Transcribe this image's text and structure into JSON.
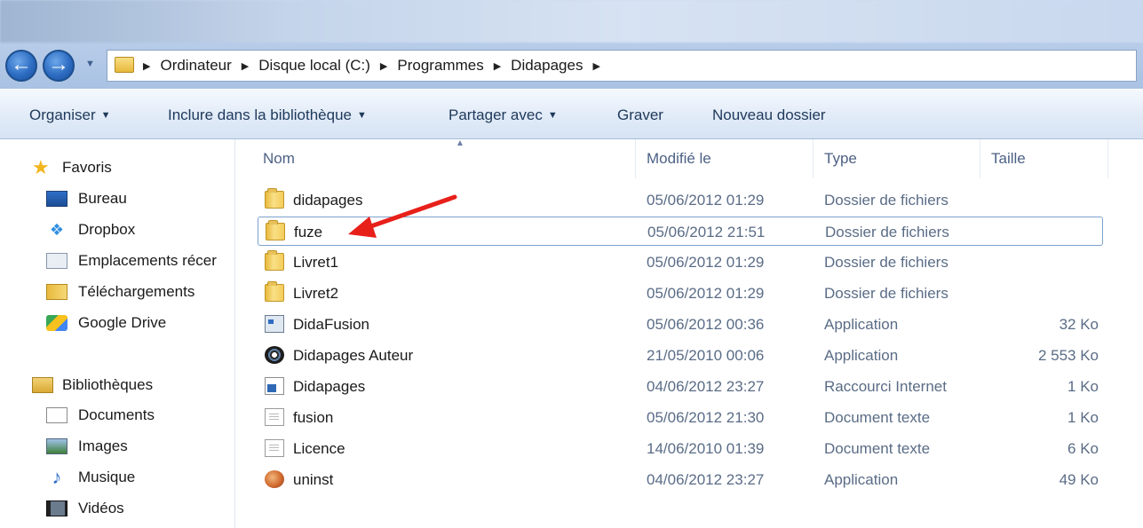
{
  "address": {
    "breadcrumbs": [
      "Ordinateur",
      "Disque local (C:)",
      "Programmes",
      "Didapages"
    ]
  },
  "toolbar": {
    "organiser": "Organiser",
    "inclure": "Inclure dans la bibliothèque",
    "partager": "Partager avec",
    "graver": "Graver",
    "nouveau_dossier": "Nouveau dossier"
  },
  "nav": {
    "favoris": "Favoris",
    "favorites": [
      "Bureau",
      "Dropbox",
      "Emplacements récer",
      "Téléchargements",
      "Google Drive"
    ],
    "bibliotheques": "Bibliothèques",
    "libraries": [
      "Documents",
      "Images",
      "Musique",
      "Vidéos"
    ]
  },
  "columns": {
    "name": "Nom",
    "modified": "Modifié le",
    "type": "Type",
    "size": "Taille"
  },
  "files": [
    {
      "icon": "folder-icon",
      "name": "didapages",
      "modified": "05/06/2012 01:29",
      "type": "Dossier de fichiers",
      "size": ""
    },
    {
      "icon": "folder-icon",
      "name": "fuze",
      "modified": "05/06/2012 21:51",
      "type": "Dossier de fichiers",
      "size": "",
      "selected": true
    },
    {
      "icon": "folder-icon",
      "name": "Livret1",
      "modified": "05/06/2012 01:29",
      "type": "Dossier de fichiers",
      "size": ""
    },
    {
      "icon": "folder-icon",
      "name": "Livret2",
      "modified": "05/06/2012 01:29",
      "type": "Dossier de fichiers",
      "size": ""
    },
    {
      "icon": "application-icon",
      "name": "DidaFusion",
      "modified": "05/06/2012 00:36",
      "type": "Application",
      "size": "32 Ko"
    },
    {
      "icon": "disc-app-icon",
      "name": "Didapages Auteur",
      "modified": "21/05/2010 00:06",
      "type": "Application",
      "size": "2 553 Ko"
    },
    {
      "icon": "internet-shortcut-icon",
      "name": "Didapages",
      "modified": "04/06/2012 23:27",
      "type": "Raccourci Internet",
      "size": "1 Ko"
    },
    {
      "icon": "text-document-icon",
      "name": "fusion",
      "modified": "05/06/2012 21:30",
      "type": "Document texte",
      "size": "1 Ko"
    },
    {
      "icon": "text-document-icon",
      "name": "Licence",
      "modified": "14/06/2010 01:39",
      "type": "Document texte",
      "size": "6 Ko"
    },
    {
      "icon": "uninstaller-icon",
      "name": "uninst",
      "modified": "04/06/2012 23:27",
      "type": "Application",
      "size": "49 Ko"
    }
  ],
  "annotation": {
    "color": "#e8201a"
  }
}
